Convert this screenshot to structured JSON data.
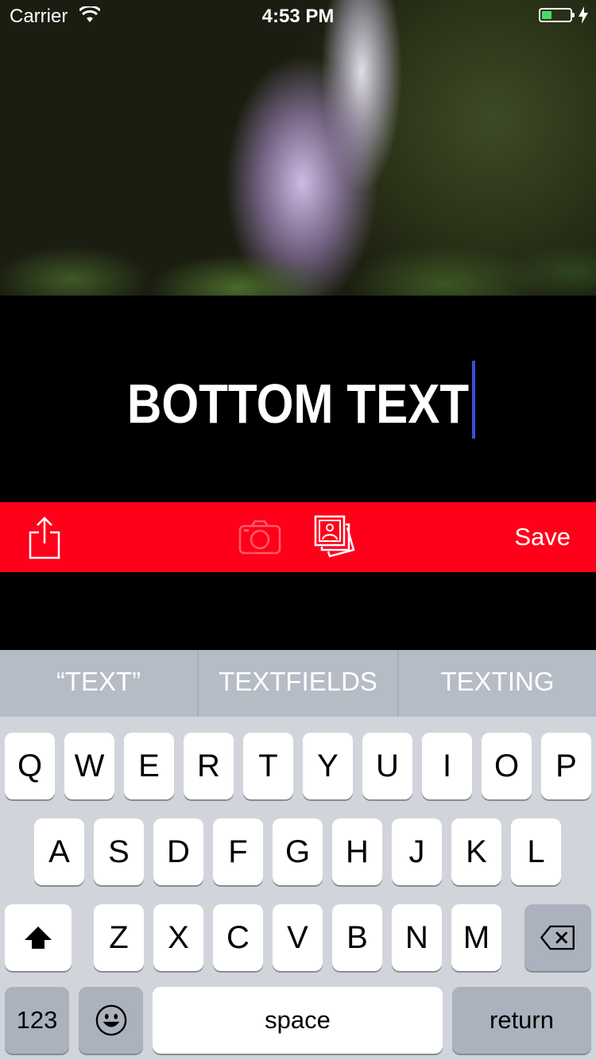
{
  "status_bar": {
    "carrier": "Carrier",
    "time": "4:53 PM",
    "battery_level": 0.35
  },
  "meme": {
    "bottom_text": "BOTTOM TEXT"
  },
  "toolbar": {
    "share_icon": "share-icon",
    "camera_icon": "camera-icon",
    "album_icon": "photo-album-icon",
    "save_label": "Save",
    "background_color": "#ff001b"
  },
  "keyboard": {
    "suggestions": [
      "“TEXT”",
      "TEXTFIELDS",
      "TEXTING"
    ],
    "row1": [
      "Q",
      "W",
      "E",
      "R",
      "T",
      "Y",
      "U",
      "I",
      "O",
      "P"
    ],
    "row2": [
      "A",
      "S",
      "D",
      "F",
      "G",
      "H",
      "J",
      "K",
      "L"
    ],
    "row3": [
      "Z",
      "X",
      "C",
      "V",
      "B",
      "N",
      "M"
    ],
    "numbers_label": "123",
    "space_label": "space",
    "return_label": "return",
    "shift_icon": "shift-icon",
    "delete_icon": "backspace-icon",
    "emoji_icon": "emoji-icon"
  }
}
